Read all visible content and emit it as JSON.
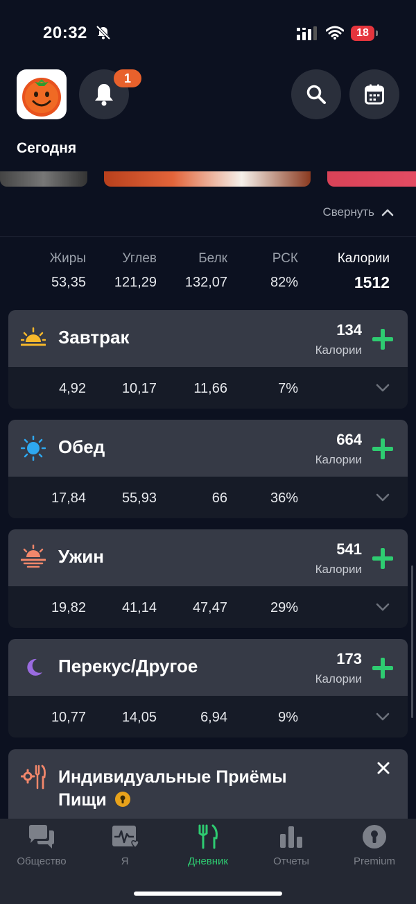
{
  "status_bar": {
    "time": "20:32",
    "battery": "18"
  },
  "header": {
    "notification_count": "1",
    "page_title": "Сегодня"
  },
  "collapse_label": "Свернуть",
  "totals": {
    "labels": [
      "Жиры",
      "Углев",
      "Белк",
      "РСК",
      "Калории"
    ],
    "values": [
      "53,35",
      "121,29",
      "132,07",
      "82%",
      "1512"
    ]
  },
  "meals": [
    {
      "name": "Завтрак",
      "calories": "134",
      "calories_label": "Калории",
      "values": [
        "4,92",
        "10,17",
        "11,66",
        "7%"
      ],
      "icon": "sunrise-icon"
    },
    {
      "name": "Обед",
      "calories": "664",
      "calories_label": "Калории",
      "values": [
        "17,84",
        "55,93",
        "66",
        "36%"
      ],
      "icon": "sun-icon"
    },
    {
      "name": "Ужин",
      "calories": "541",
      "calories_label": "Калории",
      "values": [
        "19,82",
        "41,14",
        "47,47",
        "29%"
      ],
      "icon": "sunset-icon"
    },
    {
      "name": "Перекус/Другое",
      "calories": "173",
      "calories_label": "Калории",
      "values": [
        "10,77",
        "14,05",
        "6,94",
        "9%"
      ],
      "icon": "moon-icon"
    }
  ],
  "promo": {
    "title": "Индивидуальные Приёмы Пищи"
  },
  "tabs": [
    {
      "label": "Общество",
      "icon": "chat-icon"
    },
    {
      "label": "Я",
      "icon": "heart-monitor-icon"
    },
    {
      "label": "Дневник",
      "icon": "cutlery-icon",
      "active": true
    },
    {
      "label": "Отчеты",
      "icon": "bar-chart-icon"
    },
    {
      "label": "Premium",
      "icon": "keyhole-icon"
    }
  ],
  "colors": {
    "accent_green": "#2ecc71",
    "badge_orange": "#e8612c",
    "background": "#0c1120",
    "card": "#363a46"
  }
}
